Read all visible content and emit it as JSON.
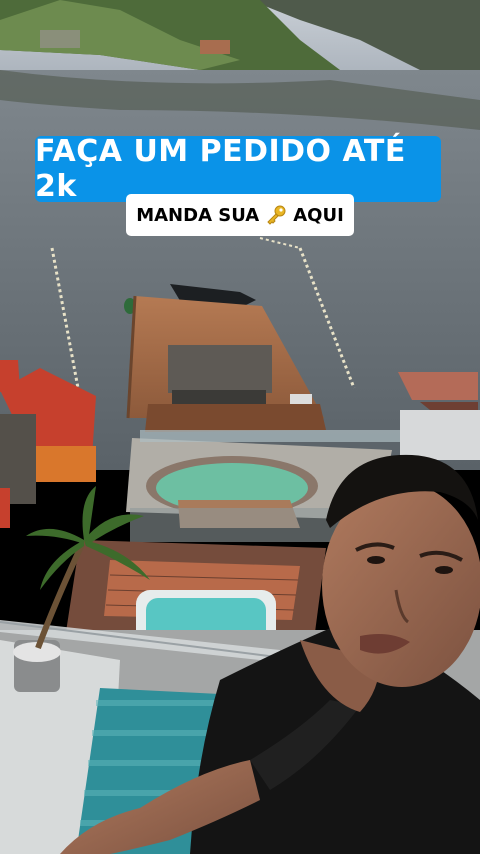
{
  "story": {
    "headline": "FAÇA UM PEDIDO ATÉ 2k",
    "sub_before": "MANDA SUA",
    "sub_icon": "key-icon",
    "sub_after": "AQUI"
  },
  "colors": {
    "headline_bg": "#0a93e8",
    "sub_bg": "#ffffff"
  }
}
